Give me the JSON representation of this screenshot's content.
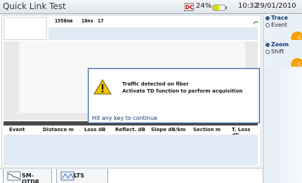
{
  "titlebar": {
    "title": "Quick Link Test",
    "battery_percent": "24%",
    "time": "10:32",
    "date": "29/01/2010",
    "status_icons": [
      "dc-power-icon",
      "battery-icon"
    ]
  },
  "acquisition_info": {
    "wavelength": "1550nm",
    "pulse_width": "10ns",
    "averages": "17"
  },
  "events_table": {
    "columns": [
      "Event",
      "Distance m",
      "Loss dB",
      "Reflect. dB",
      "Slope dB/km",
      "Section m",
      "T. Loss dB"
    ],
    "rows": []
  },
  "right_panel": {
    "group1": {
      "options": [
        "Trace",
        "Event"
      ],
      "selected": "Trace"
    },
    "group2": {
      "options": [
        "Zoom",
        "Shift"
      ],
      "selected": "Zoom"
    }
  },
  "tabs": [
    {
      "label": "SM-OTDR",
      "icon": "otdr-trace-icon",
      "active": true
    },
    {
      "label": "LTS",
      "icon": "lts-meter-icon",
      "active": false
    }
  ],
  "dialog": {
    "icon": "warning-icon",
    "line1": "Traffic detected on fiber",
    "line2": "Activate TD function to perform acquisition",
    "footer": "Hit any key to continue"
  },
  "colors": {
    "accent": "#3b5fa8",
    "panel_blue": "#dfeaf5",
    "warning": "#f2c200"
  }
}
